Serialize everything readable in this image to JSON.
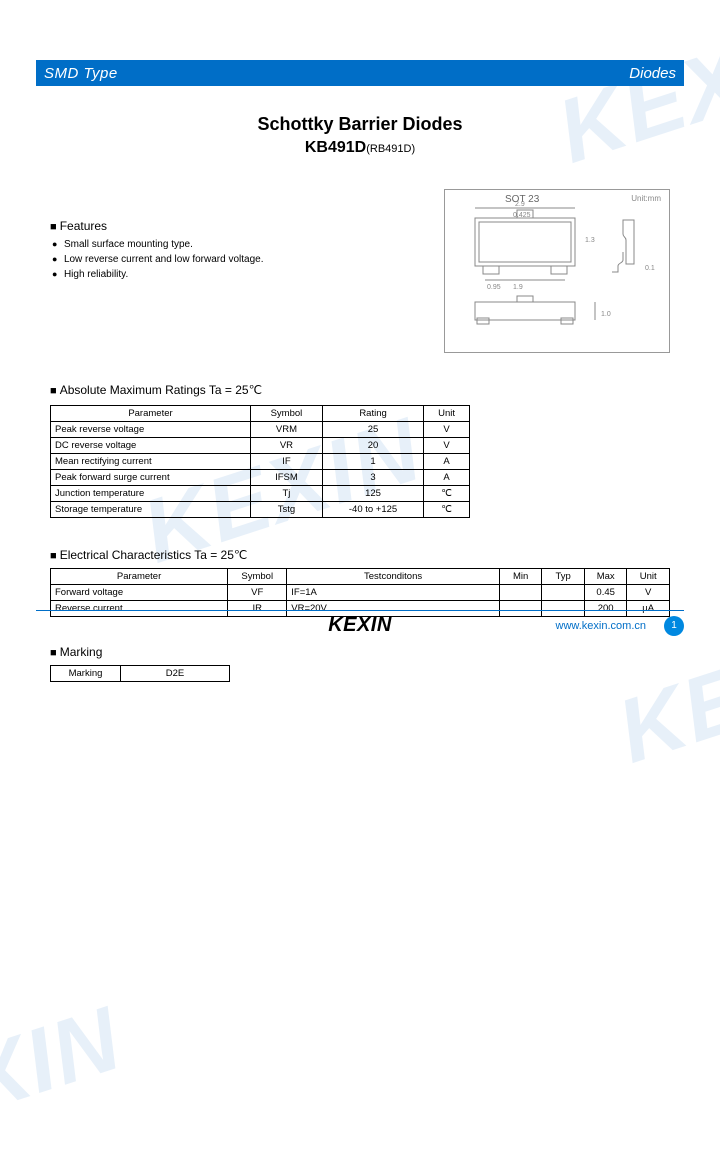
{
  "header": {
    "left": "SMD Type",
    "right": "Diodes"
  },
  "title": {
    "line1": "Schottky Barrier Diodes",
    "part": "KB491D",
    "equiv": "(RB491D)"
  },
  "features": {
    "heading": "Features",
    "items": [
      "Small surface mounting type.",
      "Low reverse current and low forward voltage.",
      "High reliability."
    ]
  },
  "package": {
    "name": "SOT 23",
    "unit": "Unit:mm",
    "dims": {
      "body_w": "2.9",
      "body_w2": "0.425",
      "lead_pitch": "1.9",
      "lead_w": "0.95",
      "h": "1.0",
      "h2": "1.3",
      "side_w": "0.1"
    }
  },
  "abs_max": {
    "heading": "Absolute Maximum Ratings Ta = 25℃",
    "cols": [
      "Parameter",
      "Symbol",
      "Rating",
      "Unit"
    ],
    "rows": [
      {
        "param": "Peak reverse voltage",
        "sym": "VRM",
        "rating": "25",
        "unit": "V"
      },
      {
        "param": "DC reverse voltage",
        "sym": "VR",
        "rating": "20",
        "unit": "V"
      },
      {
        "param": "Mean rectifying current",
        "sym": "IF",
        "rating": "1",
        "unit": "A"
      },
      {
        "param": "Peak forward surge current",
        "sym": "IFSM",
        "rating": "3",
        "unit": "A"
      },
      {
        "param": "Junction temperature",
        "sym": "Tj",
        "rating": "125",
        "unit": "℃"
      },
      {
        "param": "Storage temperature",
        "sym": "Tstg",
        "rating": "-40 to +125",
        "unit": "℃"
      }
    ]
  },
  "elec": {
    "heading": "Electrical Characteristics Ta = 25℃",
    "cols": [
      "Parameter",
      "Symbol",
      "Testconditons",
      "Min",
      "Typ",
      "Max",
      "Unit"
    ],
    "rows": [
      {
        "param": "Forward voltage",
        "sym": "VF",
        "cond": "IF=1A",
        "min": "",
        "typ": "",
        "max": "0.45",
        "unit": "V"
      },
      {
        "param": "Reverse current",
        "sym": "IR",
        "cond": "VR=20V",
        "min": "",
        "typ": "",
        "max": "200",
        "unit": "µA"
      }
    ]
  },
  "marking": {
    "heading": "Marking",
    "label": "Marking",
    "code": "D2E"
  },
  "footer": {
    "logo": "KEXIN",
    "url": "www.kexin.com.cn",
    "page": "1"
  },
  "watermark": "KEXIN"
}
